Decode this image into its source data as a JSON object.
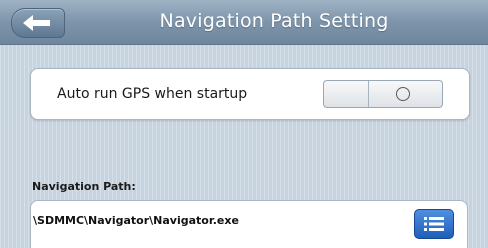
{
  "header": {
    "title": "Navigation Path Setting",
    "back_icon": "arrow-left-icon"
  },
  "settings": {
    "auto_run_label": "Auto run GPS when startup",
    "auto_run_state": "off"
  },
  "navigation_path": {
    "label": "Navigation Path:",
    "value": "\\SDMMC\\Navigator\\Navigator.exe",
    "browse_icon": "list-icon"
  },
  "colors": {
    "titlebar": "#7d94aa",
    "background": "#c7d4df",
    "browse_button": "#2f6fc8"
  }
}
